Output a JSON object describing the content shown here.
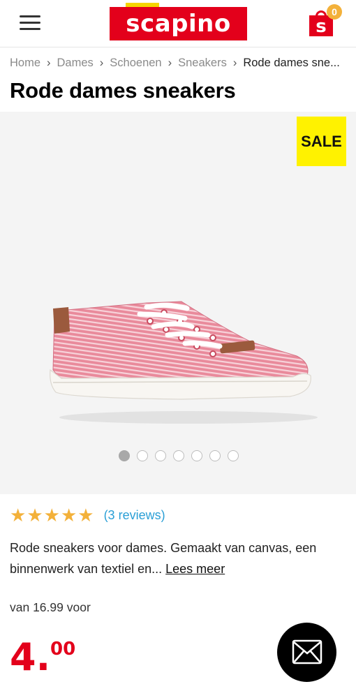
{
  "header": {
    "logo_text": "scapino",
    "cart_letter": "s",
    "cart_count": "0",
    "icons": {
      "menu": "hamburger-icon",
      "cart": "shopping-bag-icon"
    }
  },
  "breadcrumb": {
    "items": [
      "Home",
      "Dames",
      "Schoenen",
      "Sneakers"
    ],
    "current": "Rode dames sne..."
  },
  "product": {
    "title": "Rode dames sneakers",
    "sale_badge": "SALE",
    "image_count": 7,
    "active_image": 1,
    "rating_stars": 5,
    "reviews_text": "(3 reviews)",
    "description": "Rode sneakers voor dames. Gemaakt van canvas, een binnenwerk van textiel en... ",
    "read_more": "Lees meer",
    "old_price": "van 16.99 voor",
    "price_int": "4.",
    "price_dec": "00"
  },
  "colors": {
    "brand_red": "#e3001b",
    "sale_yellow": "#fff200",
    "star": "#f3b13a",
    "link_blue": "#2a9fd6"
  },
  "chat": {
    "icon": "envelope-icon"
  }
}
